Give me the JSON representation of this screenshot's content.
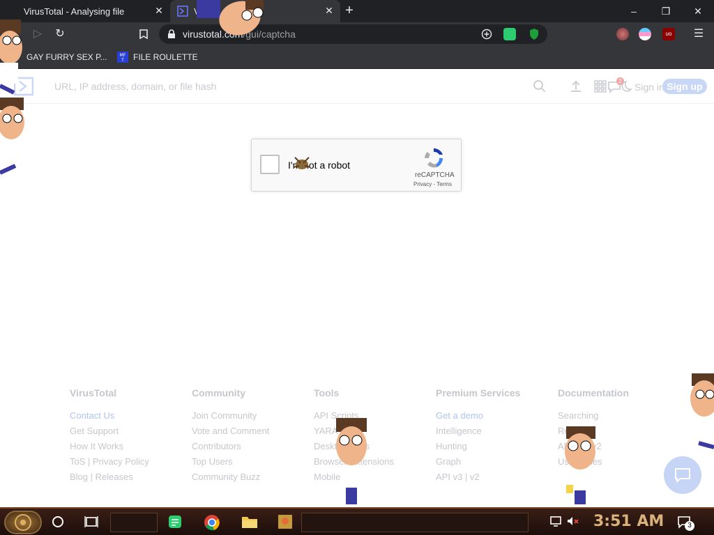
{
  "browser": {
    "tabs": [
      {
        "title": "VirusTotal - Analysing file",
        "active": false
      },
      {
        "title": "V",
        "active": true
      }
    ],
    "new_tab_label": "+",
    "window_controls": {
      "minimize": "–",
      "restore": "❐",
      "close": "✕"
    },
    "address": {
      "host": "virustotal.com",
      "path": "/gui/captcha"
    },
    "bookmarks": [
      {
        "label": "GAY FURRY SEX P...",
        "icon": "bookmark-favicon"
      },
      {
        "label": "FILE ROULETTE",
        "icon": "mft-favicon"
      }
    ]
  },
  "site": {
    "search_placeholder": "URL, IP address, domain, or file hash",
    "signin": "Sign in",
    "signup": "Sign up",
    "notification_count": "2"
  },
  "captcha": {
    "label": "I'm not a robot",
    "brand": "reCAPTCHA",
    "terms": "Privacy - Terms"
  },
  "footer": {
    "columns": [
      {
        "heading": "VirusTotal",
        "links": [
          "Contact Us",
          "Get Support",
          "How It Works",
          "ToS | Privacy Policy",
          "Blog | Releases"
        ]
      },
      {
        "heading": "Community",
        "links": [
          "Join Community",
          "Vote and Comment",
          "Contributors",
          "Top Users",
          "Community Buzz"
        ]
      },
      {
        "heading": "Tools",
        "links": [
          "API Scripts",
          "YARA",
          "Desktop Apps",
          "Browser Extensions",
          "Mobile App"
        ]
      },
      {
        "heading": "Premium Services",
        "links": [
          "Get a demo",
          "Intelligence",
          "Hunting",
          "Graph",
          "API v3 | v2"
        ]
      },
      {
        "heading": "Documentation",
        "links": [
          "Searching",
          "Reports",
          "API v3 | v2",
          "Use Cases"
        ]
      }
    ]
  },
  "taskbar": {
    "clock": "3:51 AM",
    "notification_count": "3"
  },
  "colors": {
    "chrome_dark": "#202124",
    "chrome_mid": "#35363a",
    "accent_blue": "#aec4f0",
    "footer_text": "#c5c7cc",
    "clock": "#d8b27a"
  }
}
